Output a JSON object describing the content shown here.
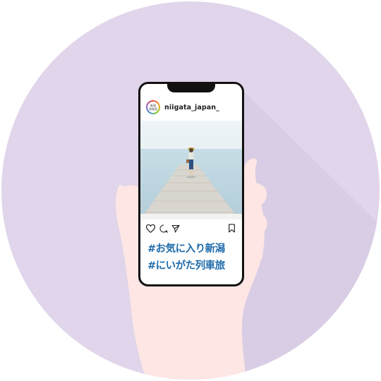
{
  "post": {
    "username": "niigata_japan_",
    "avatar_text": [
      "新潟",
      "再発見"
    ],
    "hashtags": [
      "#お気に入り新潟",
      "#にいがた列車旅"
    ]
  },
  "icons": {
    "like": "heart-icon",
    "comment": "comment-icon",
    "share": "send-icon",
    "save": "bookmark-icon"
  },
  "colors": {
    "circle": "#e0d5ea",
    "hashtag": "#1f6cab",
    "sea": "#c7dde6",
    "skin": "#fde6e4"
  }
}
